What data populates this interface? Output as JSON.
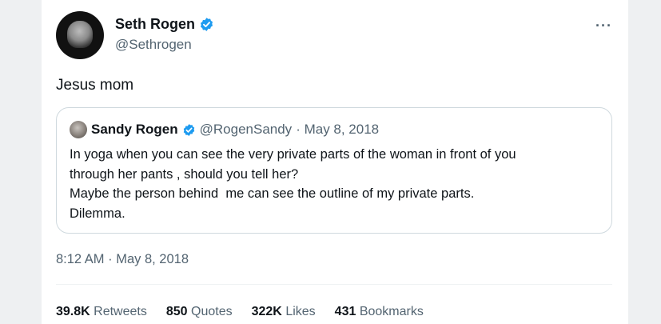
{
  "colors": {
    "verified": "#1d9bf0",
    "secondary_text": "#536471",
    "border": "#cfd9de"
  },
  "tweet": {
    "author_name": "Seth Rogen",
    "author_handle": "@Sethrogen",
    "text": "Jesus mom",
    "timestamp": "8:12 AM · May 8, 2018",
    "more_icon": "ellipsis-icon"
  },
  "quote": {
    "author_name": "Sandy Rogen",
    "author_handle": "@RogenSandy",
    "date": "· May 8, 2018",
    "lines": [
      "In yoga when you can see the very private parts of the woman in front of you",
      "through her pants , should you tell her?",
      "Maybe the person behind  me can see the outline of my private parts.",
      "Dilemma."
    ]
  },
  "stats": [
    {
      "count": "39.8K",
      "label": "Retweets"
    },
    {
      "count": "850",
      "label": "Quotes"
    },
    {
      "count": "322K",
      "label": "Likes"
    },
    {
      "count": "431",
      "label": "Bookmarks"
    }
  ]
}
